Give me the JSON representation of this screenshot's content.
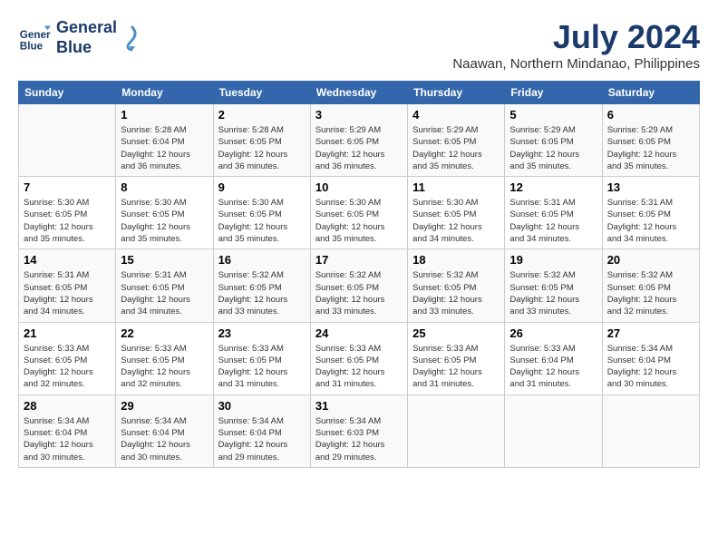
{
  "header": {
    "logo_line1": "General",
    "logo_line2": "Blue",
    "month_year": "July 2024",
    "location": "Naawan, Northern Mindanao, Philippines"
  },
  "weekdays": [
    "Sunday",
    "Monday",
    "Tuesday",
    "Wednesday",
    "Thursday",
    "Friday",
    "Saturday"
  ],
  "weeks": [
    [
      {
        "day": "",
        "info": ""
      },
      {
        "day": "1",
        "info": "Sunrise: 5:28 AM\nSunset: 6:04 PM\nDaylight: 12 hours\nand 36 minutes."
      },
      {
        "day": "2",
        "info": "Sunrise: 5:28 AM\nSunset: 6:05 PM\nDaylight: 12 hours\nand 36 minutes."
      },
      {
        "day": "3",
        "info": "Sunrise: 5:29 AM\nSunset: 6:05 PM\nDaylight: 12 hours\nand 36 minutes."
      },
      {
        "day": "4",
        "info": "Sunrise: 5:29 AM\nSunset: 6:05 PM\nDaylight: 12 hours\nand 35 minutes."
      },
      {
        "day": "5",
        "info": "Sunrise: 5:29 AM\nSunset: 6:05 PM\nDaylight: 12 hours\nand 35 minutes."
      },
      {
        "day": "6",
        "info": "Sunrise: 5:29 AM\nSunset: 6:05 PM\nDaylight: 12 hours\nand 35 minutes."
      }
    ],
    [
      {
        "day": "7",
        "info": "Sunrise: 5:30 AM\nSunset: 6:05 PM\nDaylight: 12 hours\nand 35 minutes."
      },
      {
        "day": "8",
        "info": "Sunrise: 5:30 AM\nSunset: 6:05 PM\nDaylight: 12 hours\nand 35 minutes."
      },
      {
        "day": "9",
        "info": "Sunrise: 5:30 AM\nSunset: 6:05 PM\nDaylight: 12 hours\nand 35 minutes."
      },
      {
        "day": "10",
        "info": "Sunrise: 5:30 AM\nSunset: 6:05 PM\nDaylight: 12 hours\nand 35 minutes."
      },
      {
        "day": "11",
        "info": "Sunrise: 5:30 AM\nSunset: 6:05 PM\nDaylight: 12 hours\nand 34 minutes."
      },
      {
        "day": "12",
        "info": "Sunrise: 5:31 AM\nSunset: 6:05 PM\nDaylight: 12 hours\nand 34 minutes."
      },
      {
        "day": "13",
        "info": "Sunrise: 5:31 AM\nSunset: 6:05 PM\nDaylight: 12 hours\nand 34 minutes."
      }
    ],
    [
      {
        "day": "14",
        "info": "Sunrise: 5:31 AM\nSunset: 6:05 PM\nDaylight: 12 hours\nand 34 minutes."
      },
      {
        "day": "15",
        "info": "Sunrise: 5:31 AM\nSunset: 6:05 PM\nDaylight: 12 hours\nand 34 minutes."
      },
      {
        "day": "16",
        "info": "Sunrise: 5:32 AM\nSunset: 6:05 PM\nDaylight: 12 hours\nand 33 minutes."
      },
      {
        "day": "17",
        "info": "Sunrise: 5:32 AM\nSunset: 6:05 PM\nDaylight: 12 hours\nand 33 minutes."
      },
      {
        "day": "18",
        "info": "Sunrise: 5:32 AM\nSunset: 6:05 PM\nDaylight: 12 hours\nand 33 minutes."
      },
      {
        "day": "19",
        "info": "Sunrise: 5:32 AM\nSunset: 6:05 PM\nDaylight: 12 hours\nand 33 minutes."
      },
      {
        "day": "20",
        "info": "Sunrise: 5:32 AM\nSunset: 6:05 PM\nDaylight: 12 hours\nand 32 minutes."
      }
    ],
    [
      {
        "day": "21",
        "info": "Sunrise: 5:33 AM\nSunset: 6:05 PM\nDaylight: 12 hours\nand 32 minutes."
      },
      {
        "day": "22",
        "info": "Sunrise: 5:33 AM\nSunset: 6:05 PM\nDaylight: 12 hours\nand 32 minutes."
      },
      {
        "day": "23",
        "info": "Sunrise: 5:33 AM\nSunset: 6:05 PM\nDaylight: 12 hours\nand 31 minutes."
      },
      {
        "day": "24",
        "info": "Sunrise: 5:33 AM\nSunset: 6:05 PM\nDaylight: 12 hours\nand 31 minutes."
      },
      {
        "day": "25",
        "info": "Sunrise: 5:33 AM\nSunset: 6:05 PM\nDaylight: 12 hours\nand 31 minutes."
      },
      {
        "day": "26",
        "info": "Sunrise: 5:33 AM\nSunset: 6:04 PM\nDaylight: 12 hours\nand 31 minutes."
      },
      {
        "day": "27",
        "info": "Sunrise: 5:34 AM\nSunset: 6:04 PM\nDaylight: 12 hours\nand 30 minutes."
      }
    ],
    [
      {
        "day": "28",
        "info": "Sunrise: 5:34 AM\nSunset: 6:04 PM\nDaylight: 12 hours\nand 30 minutes."
      },
      {
        "day": "29",
        "info": "Sunrise: 5:34 AM\nSunset: 6:04 PM\nDaylight: 12 hours\nand 30 minutes."
      },
      {
        "day": "30",
        "info": "Sunrise: 5:34 AM\nSunset: 6:04 PM\nDaylight: 12 hours\nand 29 minutes."
      },
      {
        "day": "31",
        "info": "Sunrise: 5:34 AM\nSunset: 6:03 PM\nDaylight: 12 hours\nand 29 minutes."
      },
      {
        "day": "",
        "info": ""
      },
      {
        "day": "",
        "info": ""
      },
      {
        "day": "",
        "info": ""
      }
    ]
  ]
}
